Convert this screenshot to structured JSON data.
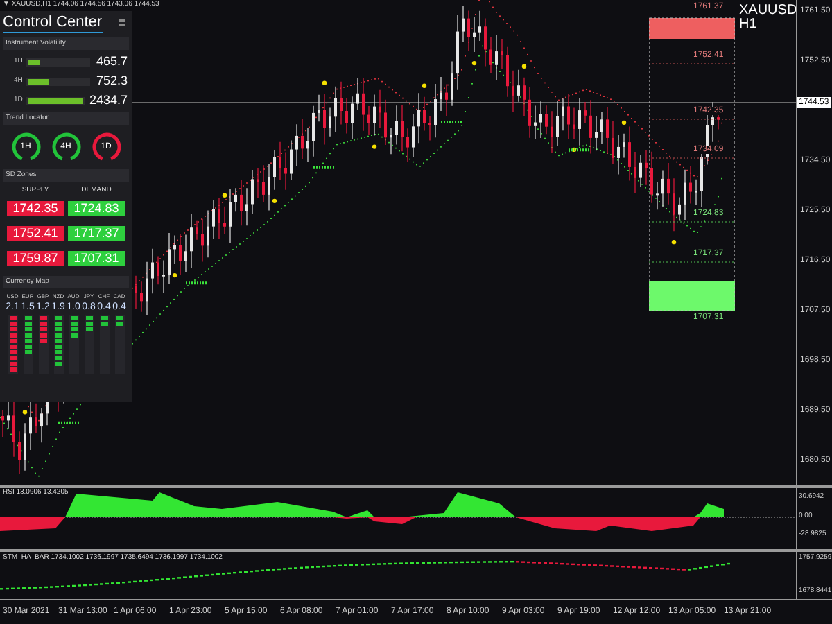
{
  "symbol_header": "▼ XAUUSD,H1 1744.06 1744.56 1743.06 1744.53",
  "chart_title": "XAUUSD H1",
  "control_center": {
    "title": "Control Center"
  },
  "volatility": {
    "title": "Instrument Volatility",
    "rows": [
      {
        "label": "1H",
        "value": "465.7",
        "level": 0.2
      },
      {
        "label": "4H",
        "value": "752.3",
        "level": 0.33
      },
      {
        "label": "1D",
        "value": "2434.7",
        "level": 1
      }
    ]
  },
  "trend_locator": {
    "title": "Trend Locator",
    "gauges": [
      {
        "label": "1H",
        "color": "#22c33a"
      },
      {
        "label": "4H",
        "color": "#22c33a"
      },
      {
        "label": "1D",
        "color": "#e8193c"
      }
    ]
  },
  "sd_zones": {
    "title": "SD Zones",
    "supply_header": "SUPPLY",
    "demand_header": "DEMAND",
    "rows": [
      {
        "supply": "1742.35",
        "demand": "1724.83"
      },
      {
        "supply": "1752.41",
        "demand": "1717.37"
      },
      {
        "supply": "1759.87",
        "demand": "1707.31"
      }
    ]
  },
  "currency_map": {
    "title": "Currency Map",
    "currencies": [
      {
        "code": "USD",
        "value": "2.1",
        "level": 1,
        "color": "#e8193c"
      },
      {
        "code": "EUR",
        "value": "1.5",
        "level": 0.7,
        "color": "#22c33a"
      },
      {
        "code": "GBP",
        "value": "1.2",
        "level": 0.5,
        "color": "#e8193c"
      },
      {
        "code": "NZD",
        "value": "1.9",
        "level": 0.9,
        "color": "#22c33a"
      },
      {
        "code": "AUD",
        "value": "1.0",
        "level": 0.4,
        "color": "#22c33a"
      },
      {
        "code": "JPY",
        "value": "0.8",
        "level": 0.3,
        "color": "#22c33a"
      },
      {
        "code": "CHF",
        "value": "0.4",
        "level": 0.2,
        "color": "#22c33a"
      },
      {
        "code": "CAD",
        "value": "0.4",
        "level": 0.2,
        "color": "#22c33a"
      }
    ]
  },
  "zone_labels": [
    "1761.37",
    "1752.41",
    "1742.35",
    "1734.09",
    "1724.83",
    "1717.37",
    "1707.31"
  ],
  "price_axis": {
    "ticks": [
      "1761.50",
      "1752.50",
      "1734.50",
      "1725.50",
      "1716.50",
      "1707.50",
      "1698.50",
      "1689.50",
      "1680.50"
    ],
    "current_price": "1744.53"
  },
  "rsi": {
    "label": "RSI 13.0906 13.4205",
    "ticks": [
      "30.6942",
      "0.00",
      "-28.9825"
    ]
  },
  "stm": {
    "label": "STM_HA_BAR 1734.1002 1736.1997 1735.6494 1736.1997 1734.1002",
    "ticks": [
      "1757.9259",
      "1678.8441"
    ]
  },
  "time_axis": [
    "30 Mar 2021",
    "31 Mar 13:00",
    "1 Apr 06:00",
    "1 Apr 23:00",
    "5 Apr 15:00",
    "6 Apr 08:00",
    "7 Apr 01:00",
    "7 Apr 17:00",
    "8 Apr 10:00",
    "9 Apr 03:00",
    "9 Apr 19:00",
    "12 Apr 12:00",
    "13 Apr 05:00",
    "13 Apr 21:00"
  ]
}
